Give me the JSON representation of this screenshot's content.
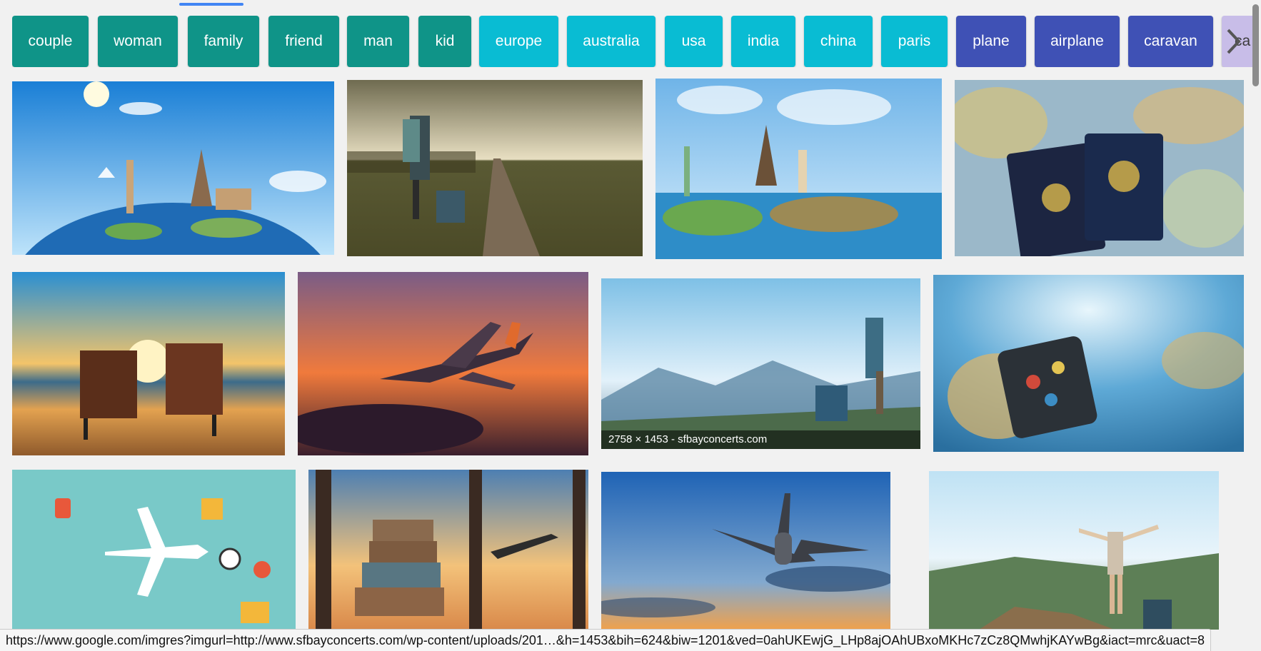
{
  "chips": [
    {
      "label": "couple",
      "color": "teal"
    },
    {
      "label": "woman",
      "color": "teal"
    },
    {
      "label": "family",
      "color": "teal"
    },
    {
      "label": "friend",
      "color": "teal"
    },
    {
      "label": "man",
      "color": "teal"
    },
    {
      "label": "kid",
      "color": "teal"
    },
    {
      "label": "europe",
      "color": "cyan"
    },
    {
      "label": "australia",
      "color": "cyan"
    },
    {
      "label": "usa",
      "color": "cyan"
    },
    {
      "label": "india",
      "color": "cyan"
    },
    {
      "label": "china",
      "color": "cyan"
    },
    {
      "label": "paris",
      "color": "cyan"
    },
    {
      "label": "plane",
      "color": "indigo"
    },
    {
      "label": "airplane",
      "color": "indigo"
    },
    {
      "label": "caravan",
      "color": "indigo"
    },
    {
      "label": "ca",
      "color": "lilac"
    }
  ],
  "colors": {
    "teal": "#0f9488",
    "cyan": "#09bcd3",
    "indigo": "#3f51b5",
    "lilac": "#c8bde8",
    "background": "#f1f1f1"
  },
  "next_icon": "chevron-right-icon",
  "images": [
    {
      "name": "image-world-landmarks-globe"
    },
    {
      "name": "image-hikers-dirt-road"
    },
    {
      "name": "image-landmarks-world-map"
    },
    {
      "name": "image-passports-on-map"
    },
    {
      "name": "image-beach-chairs-sunset"
    },
    {
      "name": "image-airplane-orange-sunset"
    },
    {
      "name": "image-hikers-mountain-view",
      "caption": "2758 × 1453 - sfbayconcerts.com"
    },
    {
      "name": "image-suitcase-on-globe"
    },
    {
      "name": "image-travel-icons-flat"
    },
    {
      "name": "image-luggage-window-plane"
    },
    {
      "name": "image-airplane-blue-sky"
    },
    {
      "name": "image-woman-arms-raised-mountain"
    }
  ],
  "status_url": "https://www.google.com/imgres?imgurl=http://www.sfbayconcerts.com/wp-content/uploads/201…&h=1453&bih=624&biw=1201&ved=0ahUKEwjG_LHp8ajOAhUBxoMKHc7zCz8QMwhjKAYwBg&iact=mrc&uact=8"
}
